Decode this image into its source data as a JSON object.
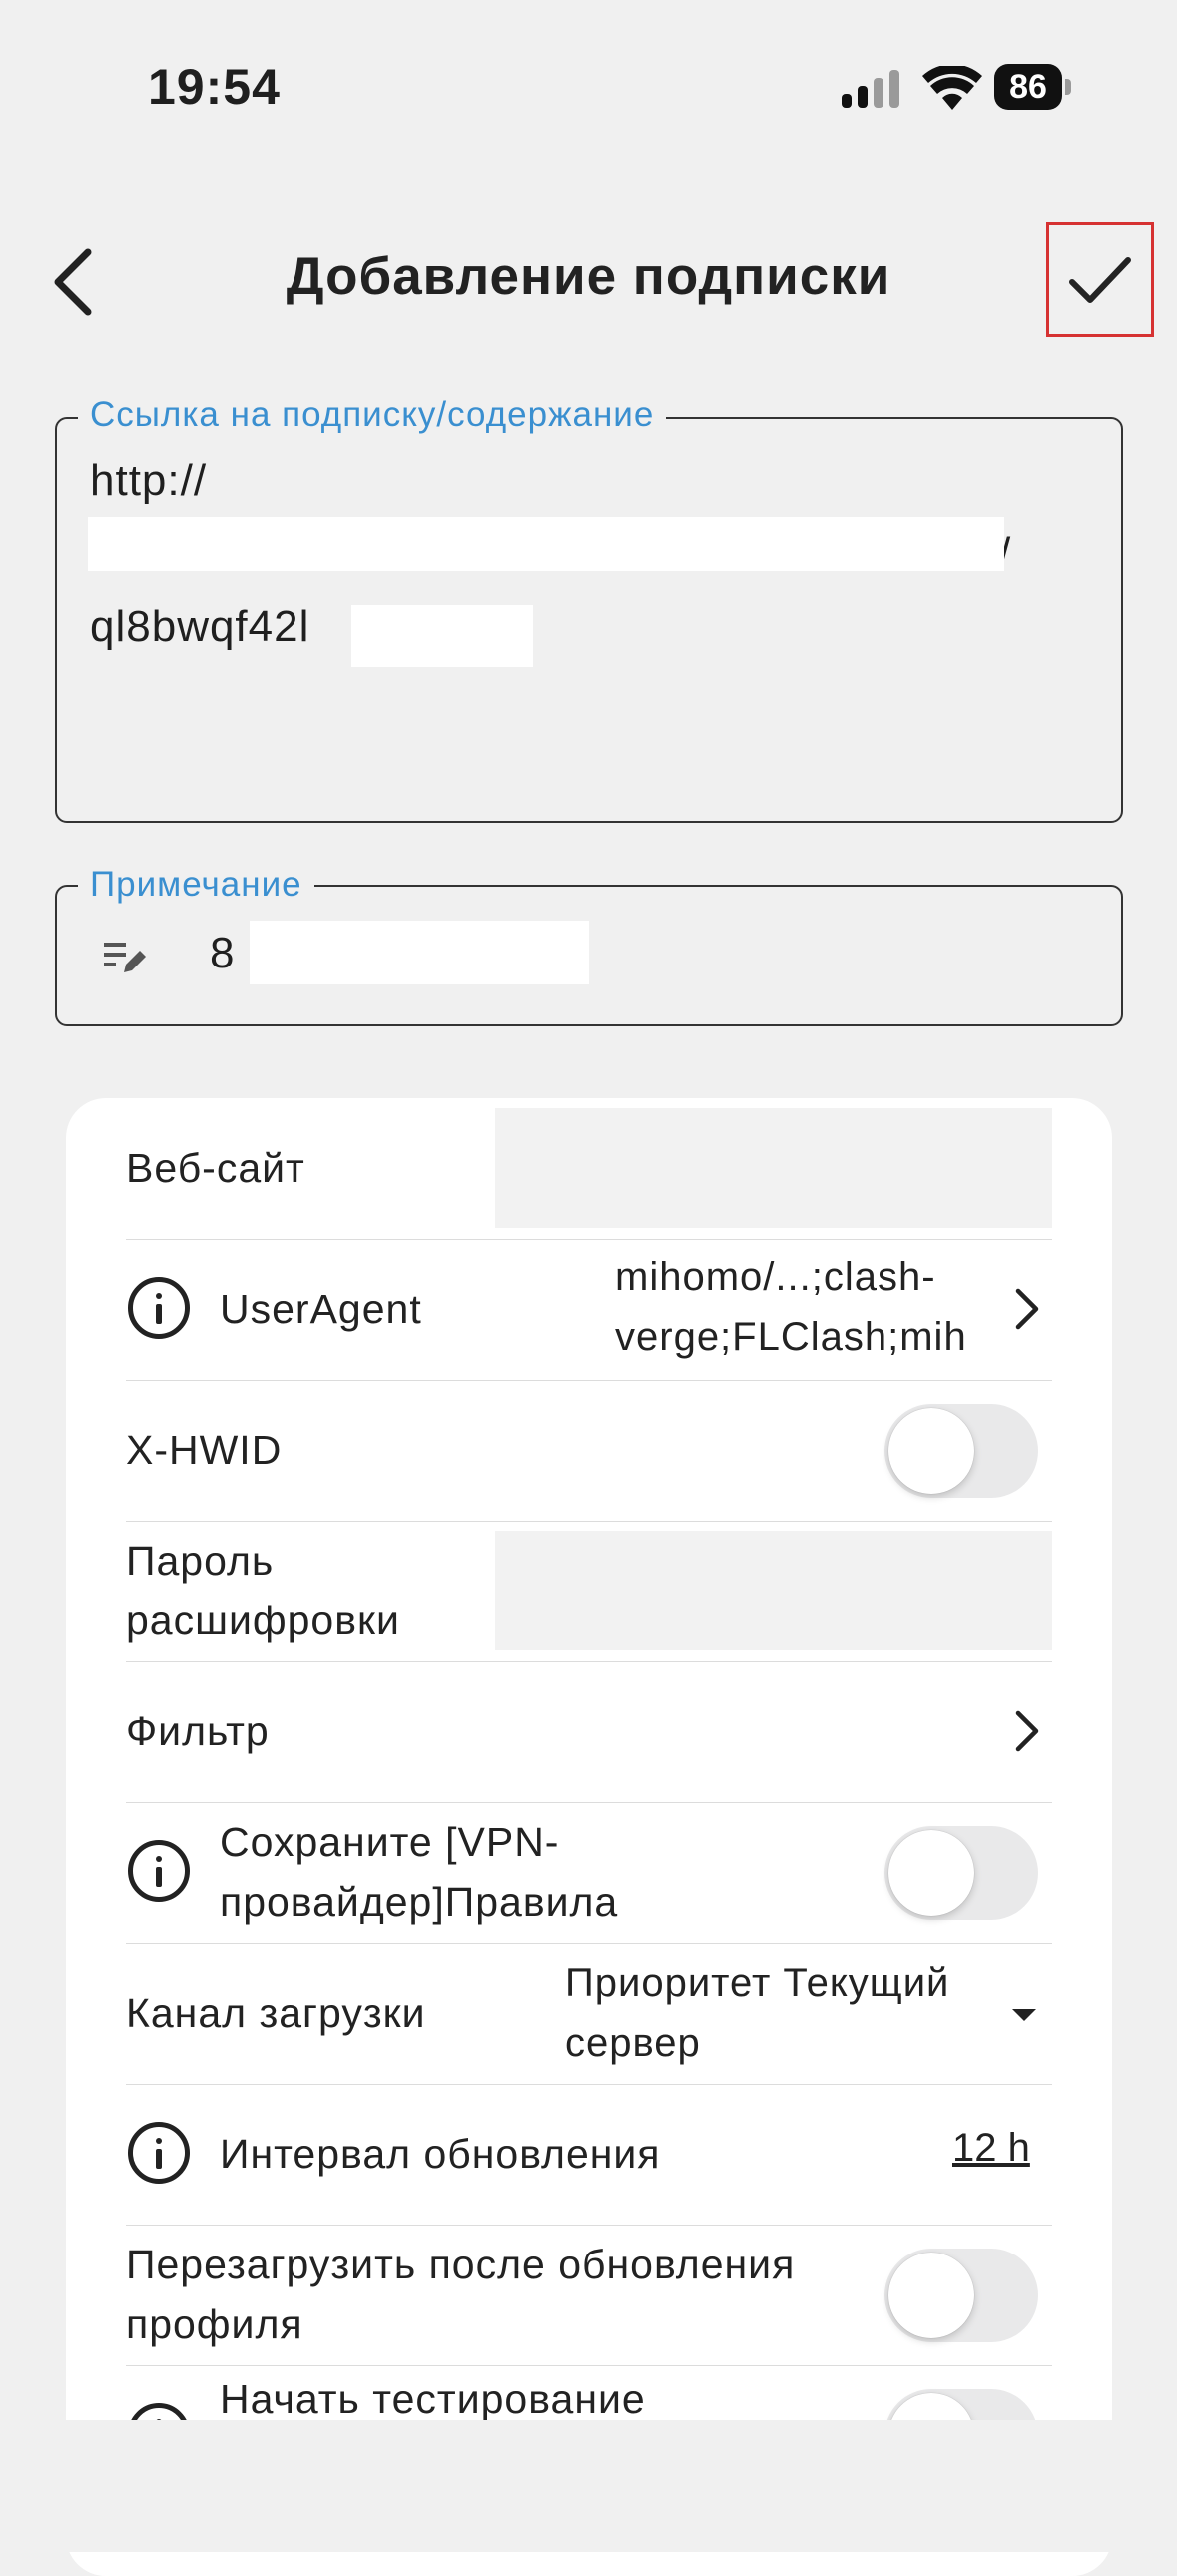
{
  "status_bar": {
    "time": "19:54",
    "battery": "86"
  },
  "header": {
    "title": "Добавление подписки"
  },
  "url_field": {
    "label": "Ссылка на подписку/содержание",
    "line1": "http://",
    "line2_end": "/",
    "line3": "ql8bwqf42l"
  },
  "note_field": {
    "label": "Примечание",
    "value": "8"
  },
  "rows": {
    "website": {
      "label": "Веб-сайт"
    },
    "user_agent": {
      "label": "UserAgent",
      "value_line1": "mihomo/...;clash-",
      "value_line2": "verge;FLClash;mih"
    },
    "x_hwid": {
      "label": "X-HWID"
    },
    "password": {
      "label_line1": "Пароль",
      "label_line2": "расшифровки"
    },
    "filter": {
      "label": "Фильтр"
    },
    "save_rules": {
      "label_line1": "Сохраните [VPN-",
      "label_line2": "провайдер]Правила"
    },
    "download_channel": {
      "label": "Канал загрузки",
      "value_line1": "Приоритет Текущий",
      "value_line2": "сервер"
    },
    "update_interval": {
      "label": "Интервал обновления",
      "value": "12 h"
    },
    "restart_after_update": {
      "label_line1": "Перезагрузить после обновления",
      "label_line2": "профиля"
    },
    "start_testing": {
      "label": "Начать тестирование"
    }
  },
  "colors": {
    "accent": "#3a8fd0",
    "highlight": "#d63232",
    "background": "#f0f0f0"
  }
}
